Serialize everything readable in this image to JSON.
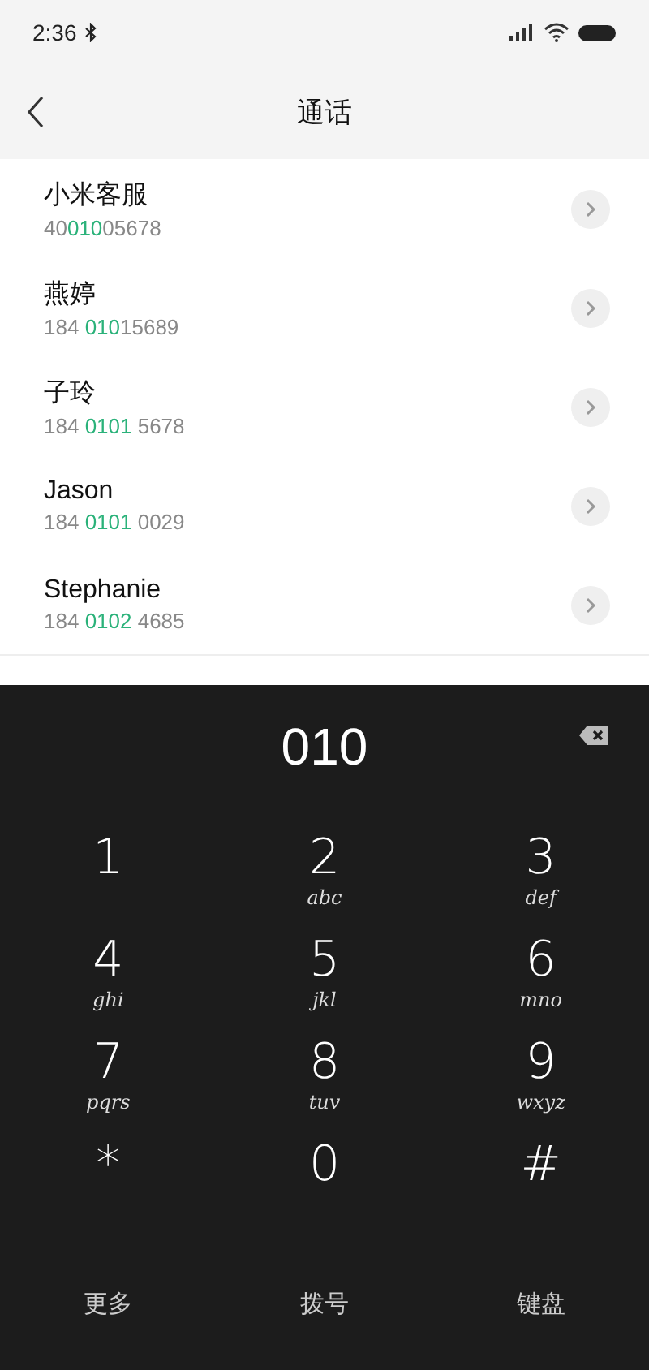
{
  "status_bar": {
    "time": "2:36"
  },
  "header": {
    "title": "通话"
  },
  "contacts": [
    {
      "name": "小米客服",
      "number": [
        {
          "text": "40",
          "match": false
        },
        {
          "text": "010",
          "match": true
        },
        {
          "text": "05678",
          "match": false
        }
      ]
    },
    {
      "name": "燕婷",
      "number": [
        {
          "text": "184 ",
          "match": false
        },
        {
          "text": "010",
          "match": true
        },
        {
          "text": "15689",
          "match": false
        }
      ]
    },
    {
      "name": "子玲",
      "number": [
        {
          "text": "184 ",
          "match": false
        },
        {
          "text": "0101",
          "match": true
        },
        {
          "text": " 5678",
          "match": false
        }
      ]
    },
    {
      "name": "Jason",
      "number": [
        {
          "text": "184 ",
          "match": false
        },
        {
          "text": "0101",
          "match": true
        },
        {
          "text": " 0029",
          "match": false
        }
      ]
    },
    {
      "name": "Stephanie",
      "number": [
        {
          "text": "184 ",
          "match": false
        },
        {
          "text": "0102",
          "match": true
        },
        {
          "text": " 4685",
          "match": false
        }
      ]
    }
  ],
  "dialpad": {
    "entered": "010",
    "keys": [
      {
        "digit": "1"
      },
      {
        "digit": "2",
        "letters": "abc"
      },
      {
        "digit": "3",
        "letters": "def"
      },
      {
        "digit": "4",
        "letters": "ghi"
      },
      {
        "digit": "5",
        "letters": "jkl"
      },
      {
        "digit": "6",
        "letters": "mno"
      },
      {
        "digit": "7",
        "letters": "pqrs"
      },
      {
        "digit": "8",
        "letters": "tuv"
      },
      {
        "digit": "9",
        "letters": "wxyz"
      },
      {
        "digit": "*"
      },
      {
        "digit": "0"
      },
      {
        "digit": "#"
      }
    ],
    "actions": [
      "更多",
      "拨号",
      "键盘"
    ]
  }
}
